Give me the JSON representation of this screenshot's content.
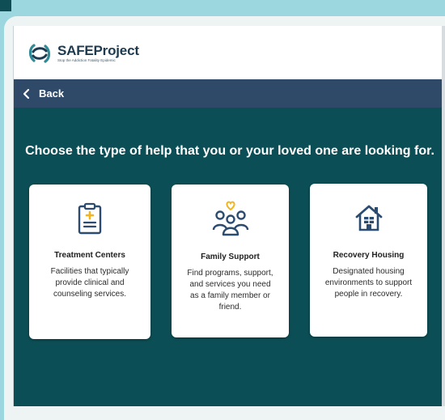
{
  "brand": {
    "name_part1": "SAFE",
    "name_part2": "Project",
    "tagline": "Stop the Addiction Fatality Epidemic",
    "colors": {
      "navy": "#1d3a4f",
      "teal": "#2f8a97"
    }
  },
  "nav": {
    "back_label": "Back",
    "back_icon": "chevron-left-icon"
  },
  "main": {
    "heading": "Choose the type of help that you or your loved one are looking for.",
    "cards": [
      {
        "icon": "clipboard-medical-icon",
        "title": "Treatment Centers",
        "description": "Facilities that typically provide clinical and counseling services."
      },
      {
        "icon": "family-heart-icon",
        "title": "Family Support",
        "description": "Find programs, support, and services you need as a family member or friend."
      },
      {
        "icon": "house-icon",
        "title": "Recovery Housing",
        "description": "Designated housing environments to support people in recovery."
      }
    ]
  },
  "colors": {
    "page_background": "#9cd6de",
    "content_background": "#0c4e55",
    "navbar_background": "#2e4a68",
    "icon_navy": "#2b4c70",
    "icon_accent": "#f2b51f"
  }
}
